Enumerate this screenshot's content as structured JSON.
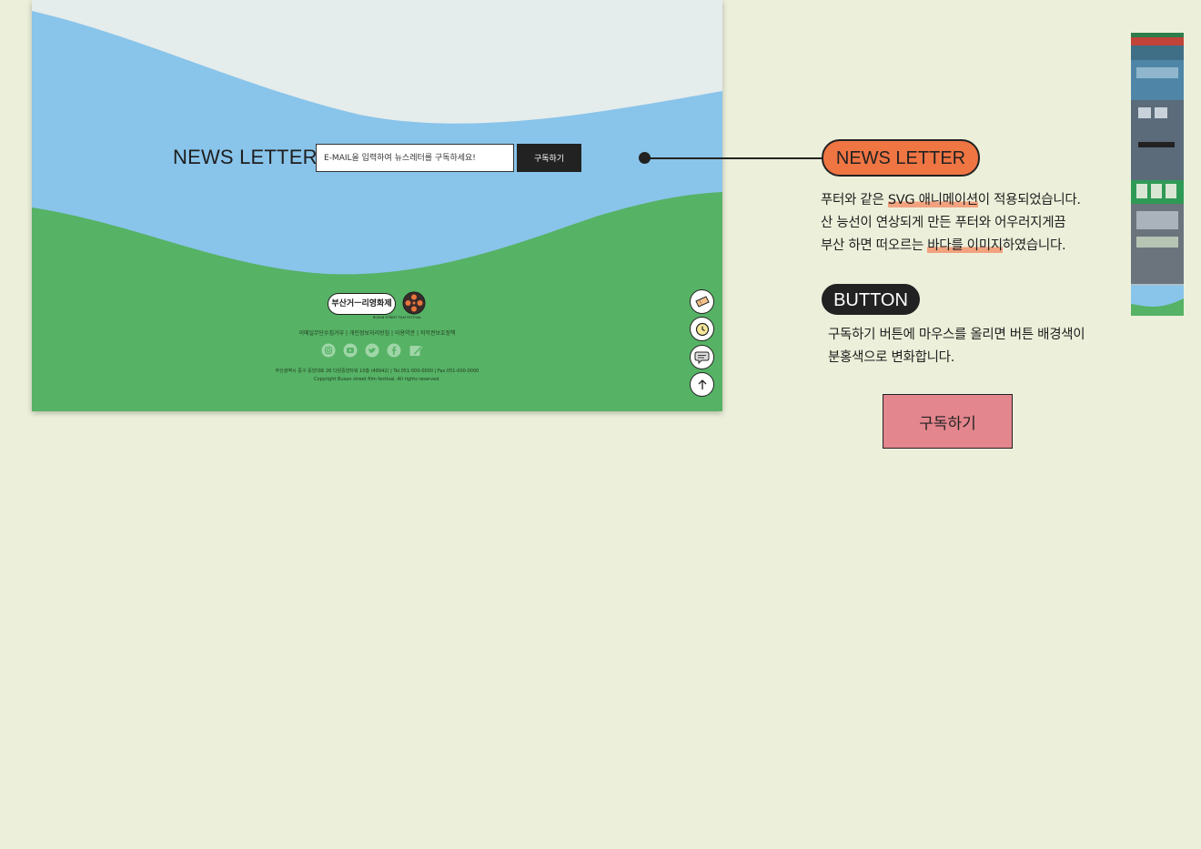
{
  "newsletter": {
    "title": "NEWS LETTER",
    "email_placeholder": "E-MAIL을 입력하여 뉴스레터를 구독하세요!",
    "subscribe_label": "구독하기"
  },
  "footer": {
    "logo_text": "부산거ㅡ리영화제",
    "logo_subtext": "BUSAN STREET FILM FESTIVAL",
    "links": "이메일무단수집거부 | 개인정보처리방침 | 이용약관 | 저작권보호정책",
    "address": "부산광역시 중구 중앙대로 26 다원중앙타워 10층 (48942) | Tel.051-000-0000 | Fax.051-000-0000",
    "copyright": "Copyright Busan street film festival. All rights reserved."
  },
  "social_icons": [
    "instagram-icon",
    "youtube-icon",
    "twitter-icon",
    "facebook-icon",
    "blog-icon"
  ],
  "quick_menu_icons": [
    "ticket-icon",
    "clock-icon",
    "chat-icon",
    "arrow-up-icon"
  ],
  "annotation": {
    "news_tag": "NEWS LETTER",
    "news_desc": {
      "line1_pre": "푸터와 같은 ",
      "line1_hl": "SVG 애니메이션",
      "line1_post": "이 적용되었습니다.",
      "line2": "산 능선이 연상되게 만든 푸터와 어우러지게끔",
      "line3_pre": "부산 하면 떠오르는 ",
      "line3_hl": "바다를 이미지",
      "line3_post": "하였습니다."
    },
    "button_tag": "BUTTON",
    "button_desc": {
      "line1": "구독하기 버튼에 마우스를 올리면 버튼 배경색이",
      "line2": "분홍색으로 변화합니다."
    },
    "demo_button_label": "구독하기"
  },
  "colors": {
    "background": "#ecf0da",
    "sky": "#e4ecec",
    "sea": "#89c4ea",
    "mountain": "#56b265",
    "accent_orange": "#ef7543",
    "hover_pink": "#e3868d",
    "dark": "#222222"
  }
}
